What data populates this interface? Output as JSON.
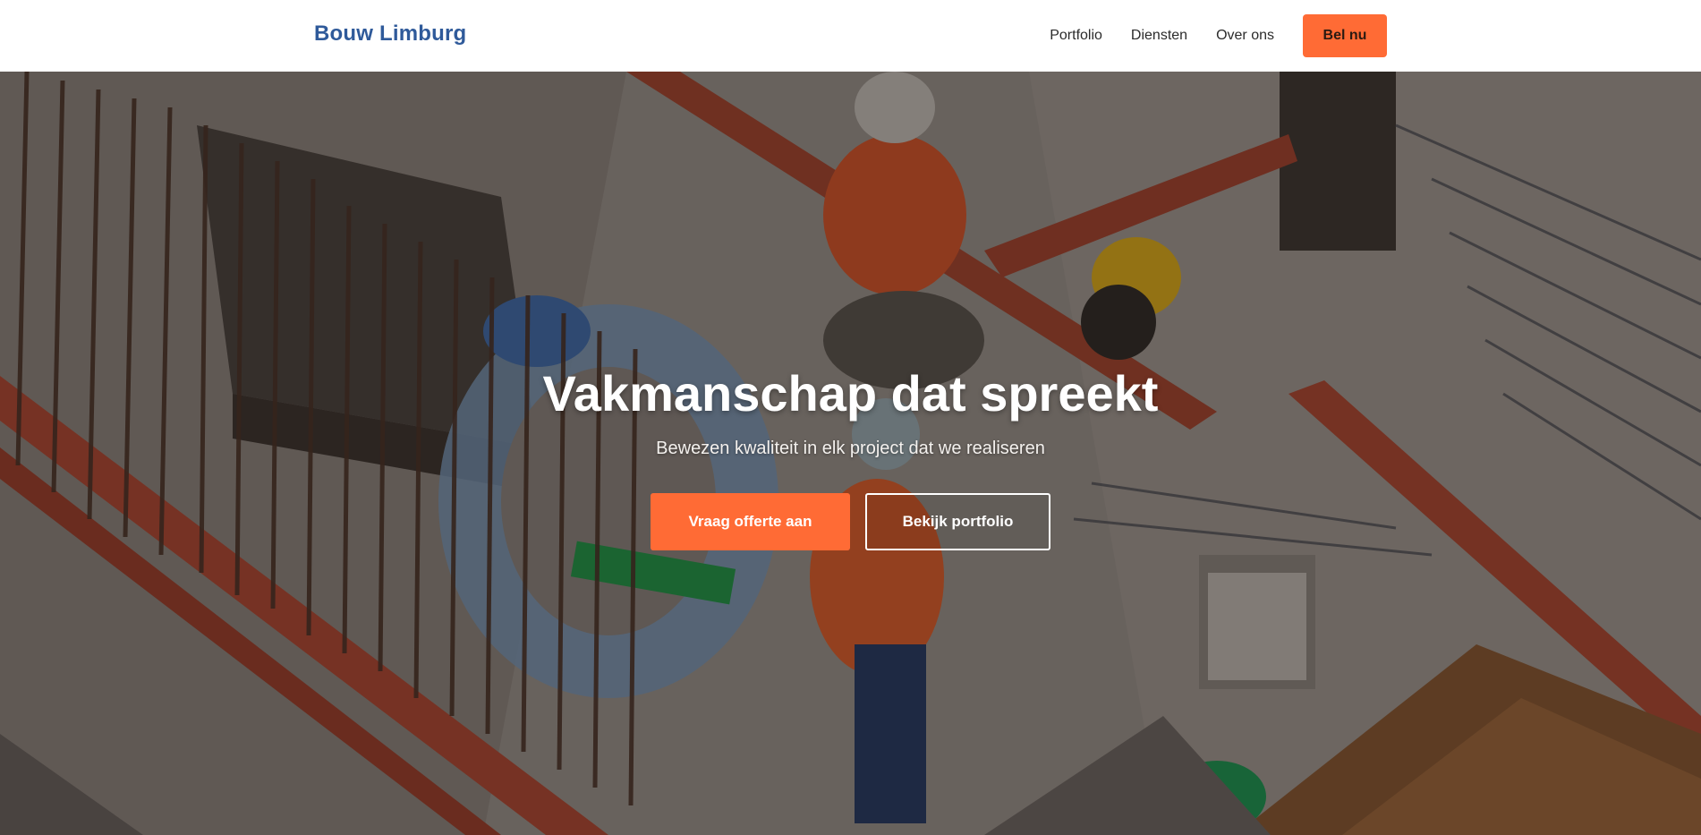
{
  "nav": {
    "logo": "Bouw Limburg",
    "links": [
      {
        "label": "Portfolio"
      },
      {
        "label": "Diensten"
      },
      {
        "label": "Over ons"
      }
    ],
    "cta_label": "Bel nu"
  },
  "hero": {
    "title": "Vakmanschap dat spreekt",
    "subtitle": "Bewezen kwaliteit in elk project dat we realiseren",
    "primary_button": "Vraag offerte aan",
    "secondary_button": "Bekijk portfolio"
  },
  "colors": {
    "accent": "#ff6b35",
    "brand": "#2f5a9a",
    "nav_text": "#2b2b2b"
  }
}
